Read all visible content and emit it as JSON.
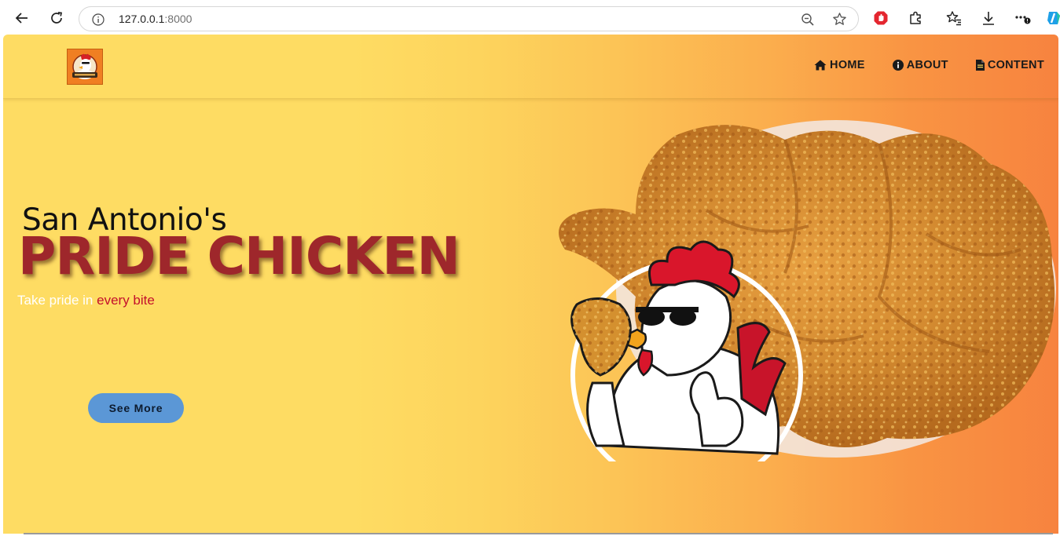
{
  "browser": {
    "url_host": "127.0.0.1",
    "url_port": ":8000"
  },
  "nav": {
    "items": [
      {
        "label": "HOME",
        "icon": "home-icon"
      },
      {
        "label": "ABOUT",
        "icon": "info-circle-icon"
      },
      {
        "label": "CONTENT",
        "icon": "file-icon"
      }
    ]
  },
  "hero": {
    "subtitle": "San Antonio's",
    "title": "PRIDE CHICKEN",
    "tagline_prefix": "Take pride in ",
    "tagline_accent": "every bite",
    "button_label": "See More"
  },
  "colors": {
    "gradient_left": "#fedc63",
    "gradient_right": "#f7833f",
    "title": "#9e272b",
    "accent": "#c4102c",
    "button": "#5b97d6"
  }
}
